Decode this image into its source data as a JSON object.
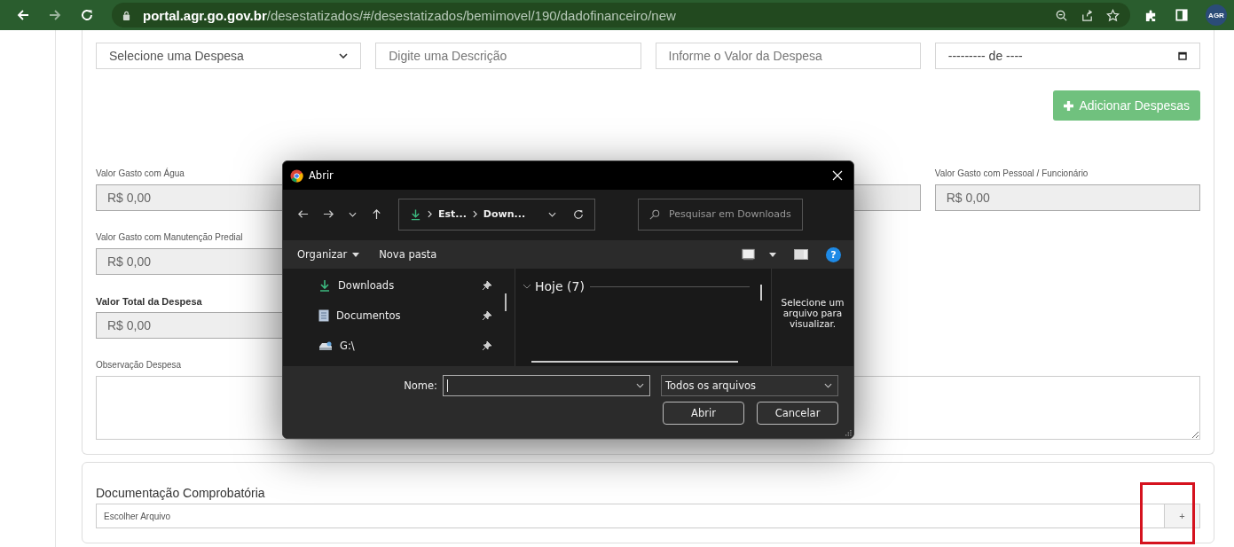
{
  "browser": {
    "url_host": "portal.agr.go.gov.br",
    "url_path": "/desestatizados/#/desestatizados/bemimovel/190/dadofinanceiro/new",
    "profile": "AGR"
  },
  "expense_form": {
    "expense_select": "Selecione uma Despesa",
    "description_placeholder": "Digite uma Descrição",
    "amount_placeholder": "Informe o Valor da Despesa",
    "date_value": "--------- de ----",
    "add_button": "Adicionar Despesas"
  },
  "summary_rows": [
    {
      "cells": [
        {
          "kind": "field",
          "label": "Valor Gasto com Água",
          "value": "R$ 0,00"
        },
        {
          "kind": "empty"
        },
        {
          "kind": "covered"
        },
        {
          "kind": "field",
          "label": "Valor Gasto com Pessoal / Funcionário",
          "value": "R$ 0,00"
        }
      ]
    },
    {
      "cells": [
        {
          "kind": "field",
          "label": "Valor Gasto com Manutenção Predial",
          "value": "R$ 0,00"
        }
      ]
    },
    {
      "cells": [
        {
          "kind": "total",
          "label": "Valor Total da Despesa",
          "value": "R$ 0,00"
        }
      ]
    }
  ],
  "notes": {
    "label": "Observação Despesa"
  },
  "documents": {
    "title": "Documentação Comprobatória",
    "file_placeholder": "Escolher Arquivo",
    "add_button": "+",
    "highlighted": true
  },
  "dialog": {
    "title": "Abrir",
    "breadcrumb": [
      "Est...",
      "Down..."
    ],
    "search_placeholder": "Pesquisar em Downloads",
    "toolbar": {
      "organize": "Organizar",
      "new_folder": "Nova pasta",
      "help": "?"
    },
    "nav_items": [
      {
        "kind": "download",
        "label": "Downloads",
        "pinned": true
      },
      {
        "kind": "document",
        "label": "Documentos",
        "pinned": true
      },
      {
        "kind": "drive",
        "label": "G:\\",
        "pinned": true
      }
    ],
    "group": {
      "label": "Hoje (7)",
      "expanded": true
    },
    "preview_hint": "Selecione um arquivo para visualizar.",
    "filename_label": "Nome:",
    "filter": "Todos os arquivos",
    "open_button": "Abrir",
    "cancel_button": "Cancelar"
  }
}
